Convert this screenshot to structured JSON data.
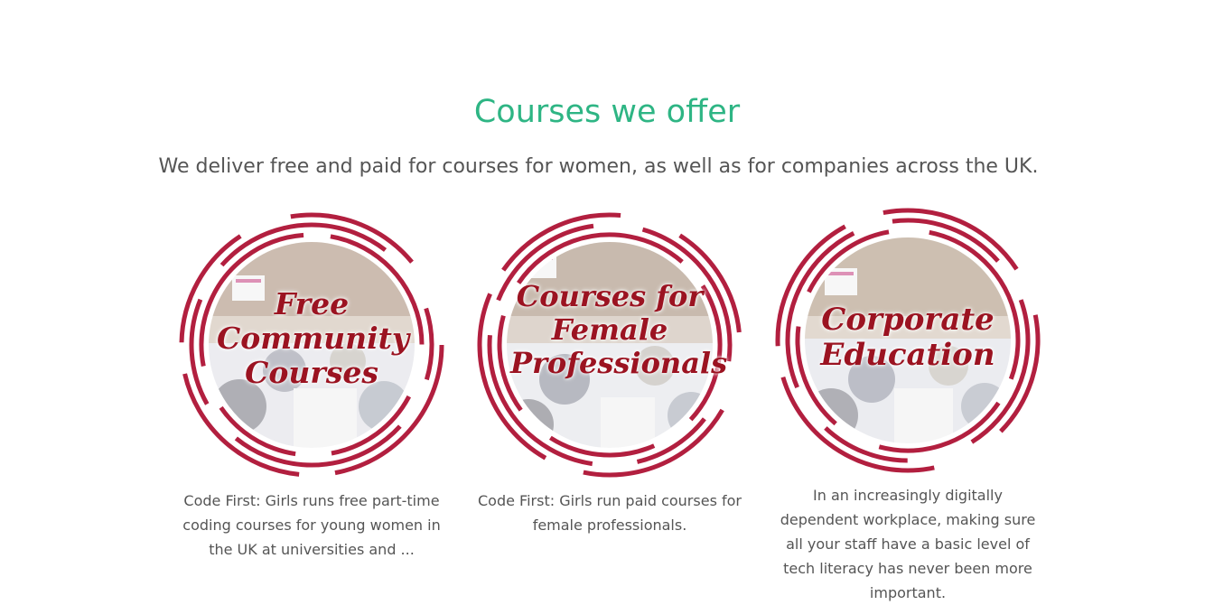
{
  "section": {
    "title": "Courses we offer",
    "subtitle": "We deliver free and paid for courses for women, as well as for companies across the UK."
  },
  "colors": {
    "accent_green": "#2eb584",
    "ring_red": "#b21f3f",
    "badge_text": "#9b1321",
    "body_text": "#555555"
  },
  "cards": [
    {
      "badge_text": "Free Community Courses",
      "description": "Code First: Girls runs free part-time coding courses for young women in the UK at universities and ..."
    },
    {
      "badge_text": "Courses for Female Professionals",
      "description": "Code First: Girls run paid courses for female professionals."
    },
    {
      "badge_text": "Corporate Education",
      "description": "In an increasingly digitally dependent workplace, making sure all your staff have a basic level of tech literacy has never been more important."
    }
  ]
}
